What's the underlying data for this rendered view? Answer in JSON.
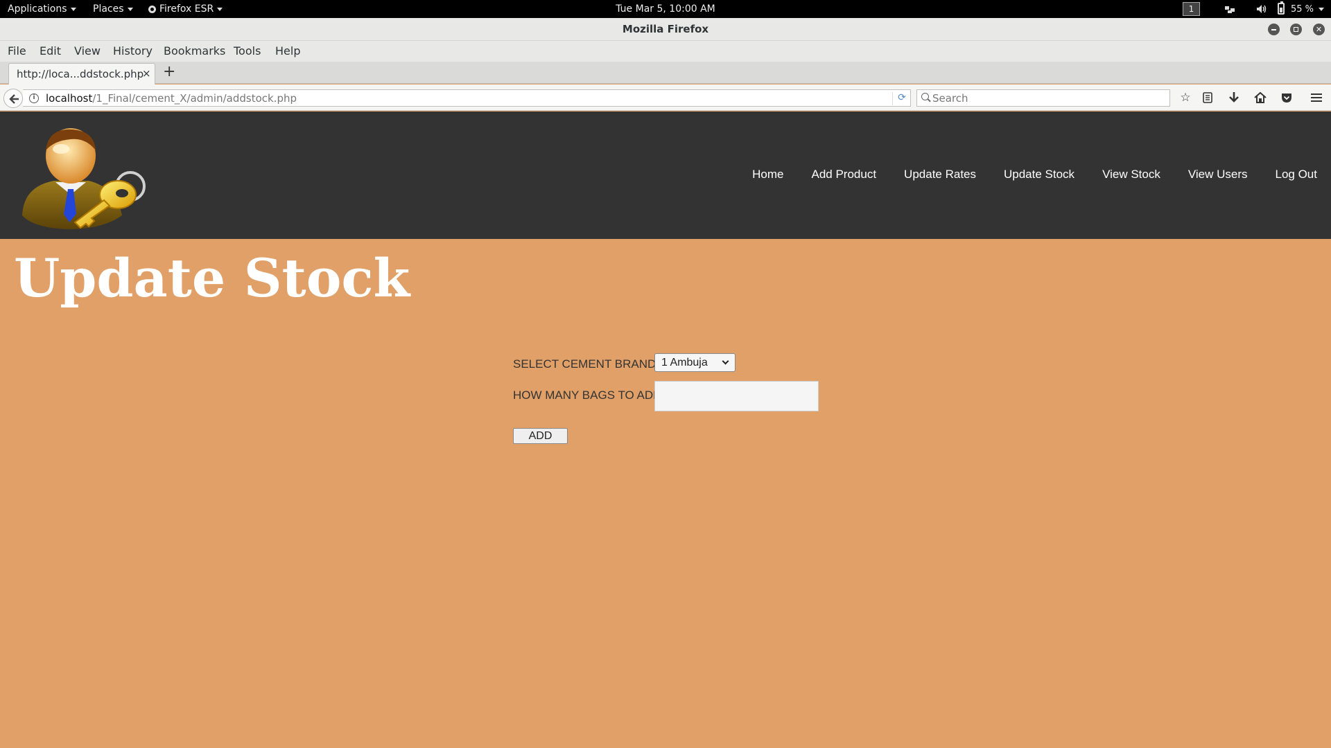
{
  "system_bar": {
    "applications": "Applications",
    "places": "Places",
    "active_app": "Firefox ESR",
    "clock": "Tue Mar  5, 10:00 AM",
    "workspace": "1",
    "battery_percent": "55 %",
    "battery_level": 0.55
  },
  "window": {
    "title": "Mozilla Firefox"
  },
  "menu": {
    "file": "File",
    "edit": "Edit",
    "view": "View",
    "history": "History",
    "bookmarks": "Bookmarks",
    "tools": "Tools",
    "help": "Help"
  },
  "tab": {
    "title": "http://loca...ddstock.php",
    "close": "×",
    "new_tab": "+"
  },
  "navbar": {
    "url_host": "localhost",
    "url_path": "/1_Final/cement_X/admin/addstock.php",
    "search_placeholder": "Search"
  },
  "site": {
    "nav": [
      "Home",
      "Add Product",
      "Update Rates",
      "Update Stock",
      "View Stock",
      "View Users",
      "Log Out"
    ]
  },
  "page": {
    "title": "Update Stock",
    "brand_label": "SELECT CEMENT BRAND",
    "brand_selected": "1 Ambuja",
    "bags_label": "HOW MANY BAGS TO ADD",
    "bags_value": "",
    "add_button": "ADD"
  },
  "colors": {
    "page_background": "#e0a068",
    "header_background": "#333333",
    "title_color": "#ffffff"
  }
}
